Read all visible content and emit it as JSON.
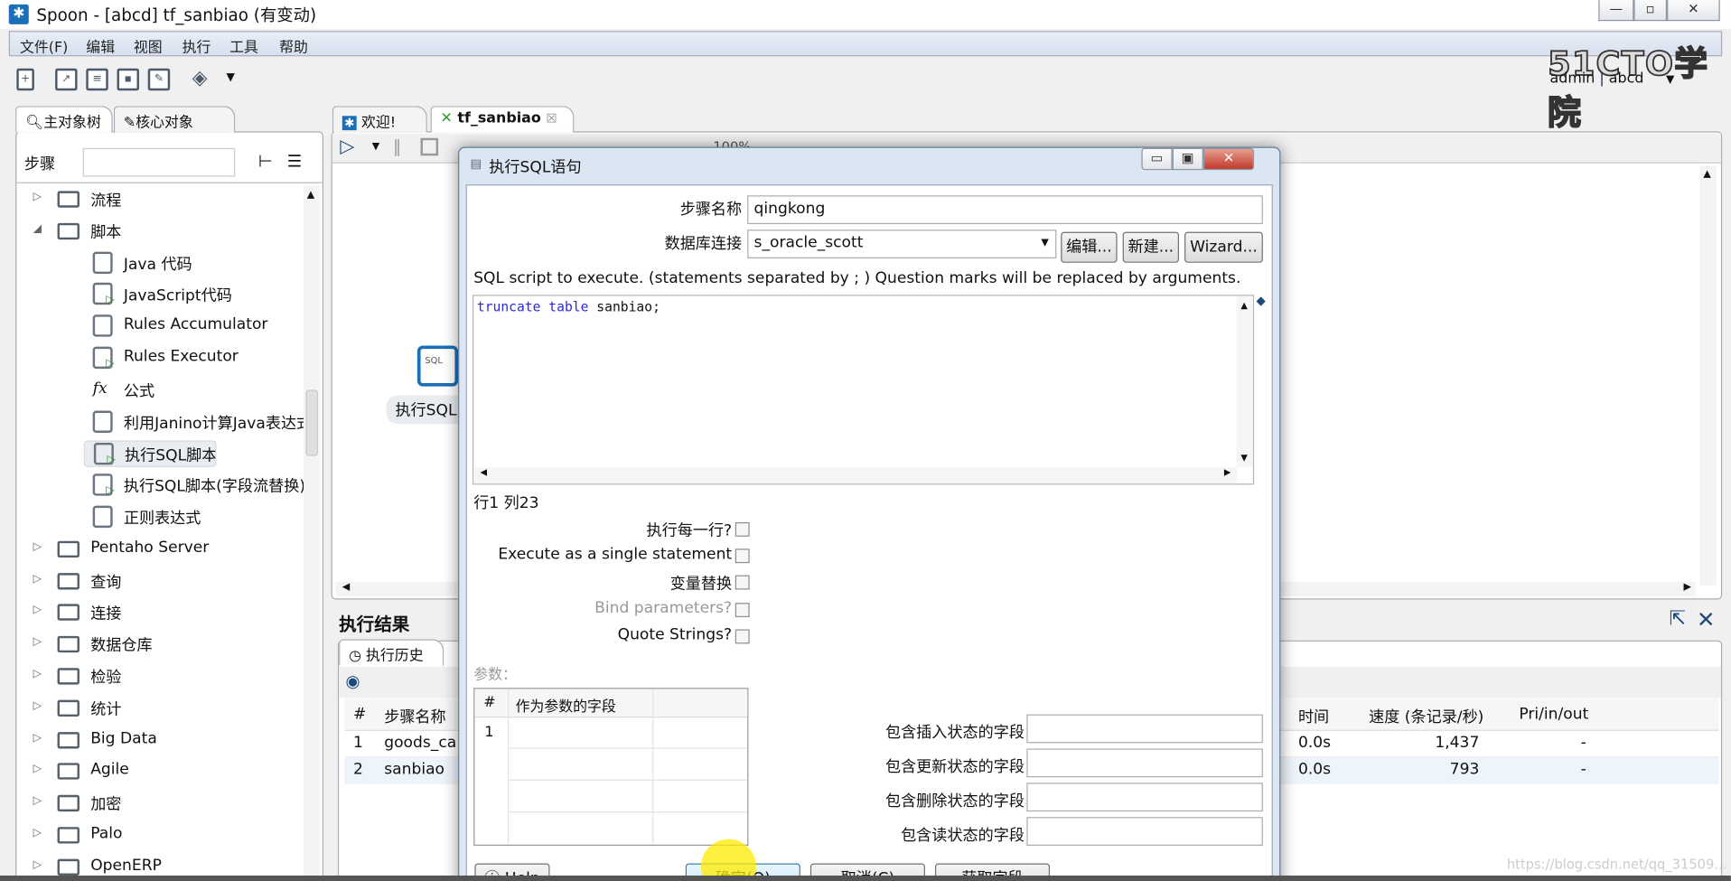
{
  "window": {
    "title": "Spoon - [abcd] tf_sanbiao (有变动)",
    "controls": [
      "minimize",
      "maximize",
      "close"
    ]
  },
  "menu": [
    "文件(F)",
    "编辑",
    "视图",
    "执行",
    "工具",
    "帮助"
  ],
  "toolbar_icons": [
    "new-file-icon",
    "open-icon",
    "explore-icon",
    "save-icon",
    "save-as-icon",
    "layers-icon"
  ],
  "branding": {
    "logo": "51CTO学院",
    "user": "admin",
    "repo": "abcd"
  },
  "left_panel": {
    "tabs": [
      "主对象树",
      "核心对象"
    ],
    "search_label": "步骤",
    "search_value": "",
    "tree": [
      {
        "label": "流程",
        "type": "folder",
        "expanded": false
      },
      {
        "label": "脚本",
        "type": "folder",
        "expanded": true
      },
      {
        "label": "Java 代码",
        "type": "child"
      },
      {
        "label": "JavaScript代码",
        "type": "child"
      },
      {
        "label": "Rules Accumulator",
        "type": "child"
      },
      {
        "label": "Rules Executor",
        "type": "child"
      },
      {
        "label": "公式",
        "type": "child"
      },
      {
        "label": "利用Janino计算Java表达式",
        "type": "child"
      },
      {
        "label": "执行SQL脚本",
        "type": "child",
        "selected": true
      },
      {
        "label": "执行SQL脚本(字段流替换)",
        "type": "child"
      },
      {
        "label": "正则表达式",
        "type": "child"
      },
      {
        "label": "Pentaho Server",
        "type": "folder"
      },
      {
        "label": "查询",
        "type": "folder"
      },
      {
        "label": "连接",
        "type": "folder"
      },
      {
        "label": "数据仓库",
        "type": "folder"
      },
      {
        "label": "检验",
        "type": "folder"
      },
      {
        "label": "统计",
        "type": "folder"
      },
      {
        "label": "Big Data",
        "type": "folder"
      },
      {
        "label": "Agile",
        "type": "folder"
      },
      {
        "label": "加密",
        "type": "folder"
      },
      {
        "label": "Palo",
        "type": "folder"
      },
      {
        "label": "OpenERP",
        "type": "folder"
      }
    ]
  },
  "editor": {
    "tabs": [
      "欢迎!",
      "tf_sanbiao"
    ],
    "zoom": "100%",
    "canvas_step_label": "执行SQL"
  },
  "results": {
    "title": "执行结果",
    "tab": "执行历史",
    "columns_left": [
      "#",
      "步骤名称"
    ],
    "columns_right": [
      "时间",
      "速度 (条记录/秒)",
      "Pri/in/out"
    ],
    "rows": [
      {
        "num": "1",
        "name": "goods_ca",
        "time": "0.0s",
        "speed": "1,437",
        "pri": "-"
      },
      {
        "num": "2",
        "name": "sanbiao",
        "time": "0.0s",
        "speed": "793",
        "pri": "-"
      }
    ]
  },
  "dialog": {
    "title": "执行SQL语句",
    "step_name_label": "步骤名称",
    "step_name": "qingkong",
    "db_label": "数据库连接",
    "db_value": "s_oracle_scott",
    "edit_btn": "编辑...",
    "new_btn": "新建...",
    "wizard_btn": "Wizard...",
    "sql_hint": "SQL script to execute. (statements separated by ; ) Question marks will be replaced by arguments.",
    "sql_keywords": "truncate table",
    "sql_rest": " sanbiao;",
    "cursor_pos": "行1 列23",
    "options": [
      {
        "label": "执行每一行?",
        "checked": false,
        "enabled": true
      },
      {
        "label": "Execute as a single statement",
        "checked": false,
        "enabled": true
      },
      {
        "label": "变量替换",
        "checked": false,
        "enabled": true
      },
      {
        "label": "Bind parameters?",
        "checked": false,
        "enabled": false
      },
      {
        "label": "Quote Strings?",
        "checked": false,
        "enabled": true
      }
    ],
    "params_label": "参数：",
    "params_columns": [
      "#",
      "作为参数的字段"
    ],
    "params_rows": [
      "1"
    ],
    "status_fields": [
      "包含插入状态的字段",
      "包含更新状态的字段",
      "包含删除状态的字段",
      "包含读状态的字段"
    ],
    "buttons": {
      "help": "Help",
      "ok": "确定(O)",
      "cancel": "取消(C)",
      "get_fields": "获取字段"
    }
  },
  "watermark": "https://blog.csdn.net/qq_31509..."
}
